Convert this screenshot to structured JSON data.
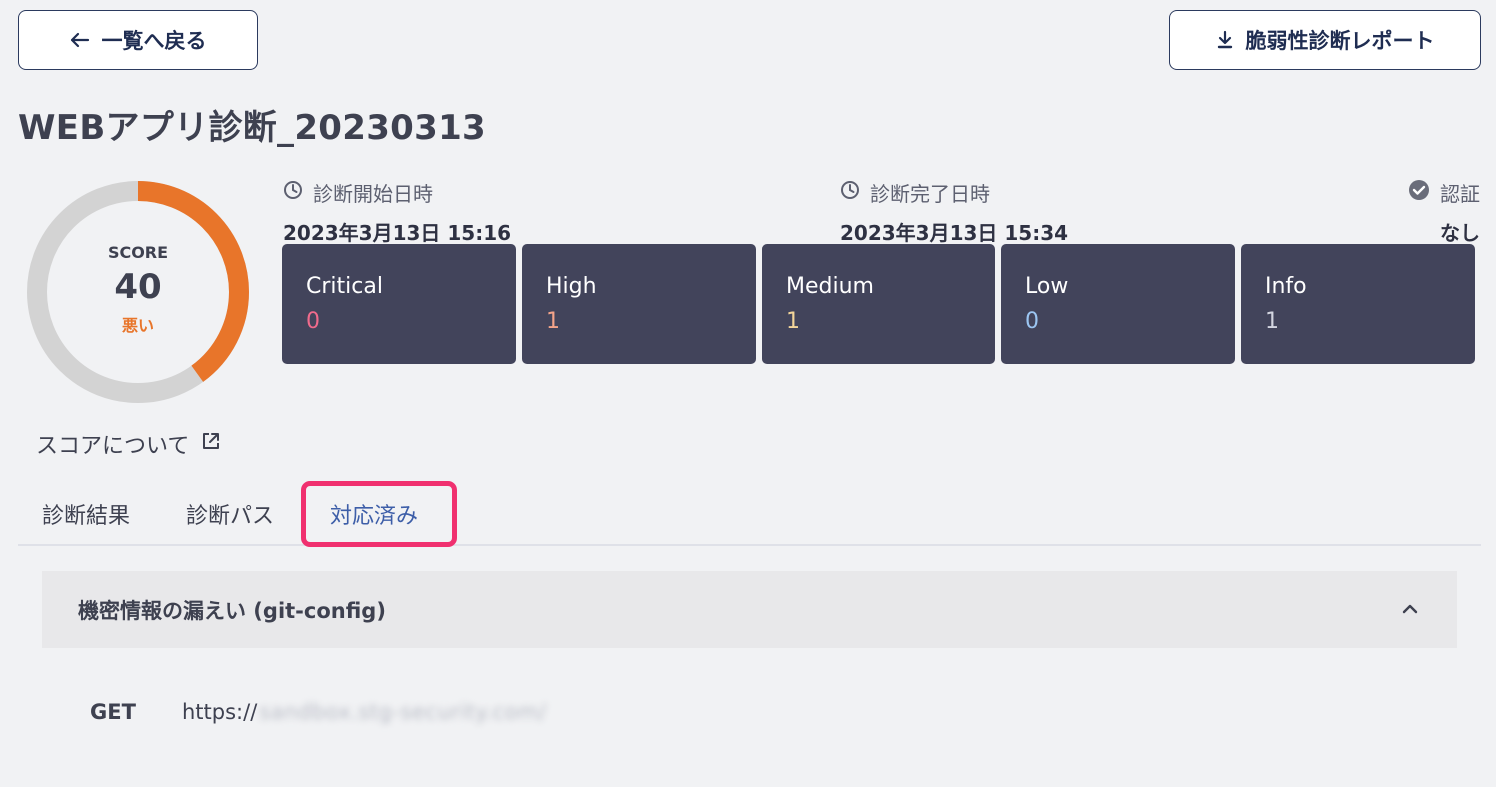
{
  "header": {
    "back_label": "一覧へ戻る",
    "report_label": "脆弱性診断レポート"
  },
  "page_title": "WEBアプリ診断_20230313",
  "score": {
    "label": "SCORE",
    "value": "40",
    "grade": "悪い",
    "progress_percent": 40,
    "link_label": "スコアについて"
  },
  "meta": {
    "start_label": "診断開始日時",
    "start_value": "2023年3月13日 15:16",
    "end_label": "診断完了日時",
    "end_value": "2023年3月13日 15:34",
    "auth_label": "認証",
    "auth_value": "なし"
  },
  "severities": [
    {
      "name": "Critical",
      "count": "0",
      "color": "#f06b8c"
    },
    {
      "name": "High",
      "count": "1",
      "color": "#f4a48a"
    },
    {
      "name": "Medium",
      "count": "1",
      "color": "#f3d59a"
    },
    {
      "name": "Low",
      "count": "0",
      "color": "#9cc6f2"
    },
    {
      "name": "Info",
      "count": "1",
      "color": "#d3d5e0"
    }
  ],
  "tabs": [
    {
      "label": "診断結果",
      "active": false
    },
    {
      "label": "診断パス",
      "active": false
    },
    {
      "label": "対応済み",
      "active": true
    }
  ],
  "colors": {
    "accent": "#e8752a",
    "active_tab": "#3d5ea8",
    "highlight": "#f0306f",
    "card_bg": "#42445b"
  },
  "finding": {
    "title": "機密情報の漏えい (git-config)",
    "method": "GET",
    "url_prefix": "https://",
    "url_blurred": "sandbox.stg-security.com/"
  }
}
